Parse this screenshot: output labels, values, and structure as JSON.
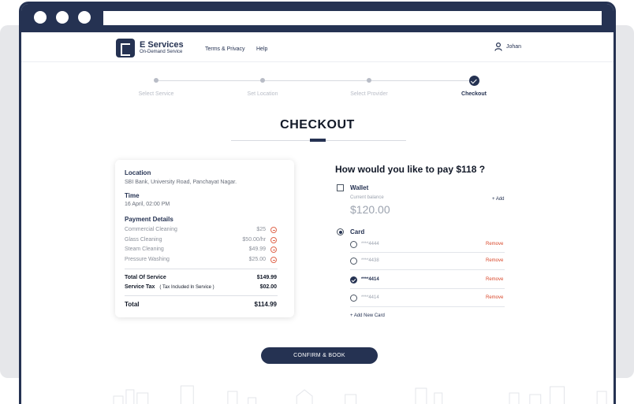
{
  "brand": {
    "title": "E Services",
    "subtitle": "On-Demand Service"
  },
  "nav": {
    "links": [
      "Terms & Privacy",
      "Help"
    ],
    "user": "Johan"
  },
  "steps": [
    {
      "label": "Select Service",
      "done": false
    },
    {
      "label": "Set Location",
      "done": false
    },
    {
      "label": "Select Provider",
      "done": false
    },
    {
      "label": "Checkout",
      "done": true
    }
  ],
  "page_title": "CHECKOUT",
  "summary": {
    "location_label": "Location",
    "location": "SBI Bank, University Road, Panchayat Nagar.",
    "time_label": "Time",
    "time": "16 April, 02:00 PM",
    "details_label": "Payment Details",
    "items": [
      {
        "name": "Commercial Cleaning",
        "price": "$25"
      },
      {
        "name": "Glass Cleaning",
        "price": "$50.00/hr"
      },
      {
        "name": "Steam Cleaning",
        "price": "$49.99"
      },
      {
        "name": "Pressure Washing",
        "price": "$25.00"
      }
    ],
    "total_of_service_label": "Total Of Service",
    "total_of_service": "$149.99",
    "service_tax_label": "Service Tax",
    "service_tax_note": "( Tax Included In Service )",
    "service_tax": "$02.00",
    "total_label": "Total",
    "total": "$114.99"
  },
  "payment": {
    "heading": "How would you like to pay $118 ?",
    "wallet_label": "Wallet",
    "wallet_sub": "Current balance",
    "wallet_balance": "$120.00",
    "add_label": "+ Add",
    "card_label": "Card",
    "cards": [
      {
        "number": "****4444",
        "selected": false
      },
      {
        "number": "****4438",
        "selected": false
      },
      {
        "number": "****4414",
        "selected": true
      },
      {
        "number": "****4414",
        "selected": false
      }
    ],
    "remove_label": "Remove",
    "add_card_label": "+ Add New Card"
  },
  "confirm_label": "CONFIRM & BOOK",
  "colors": {
    "primary": "#253252",
    "danger": "#d9482b",
    "muted": "#9ca3af"
  },
  "icons": [
    "user-icon",
    "minus-circle-icon",
    "check-icon",
    "checkbox-icon",
    "radio-icon",
    "logo-icon"
  ]
}
